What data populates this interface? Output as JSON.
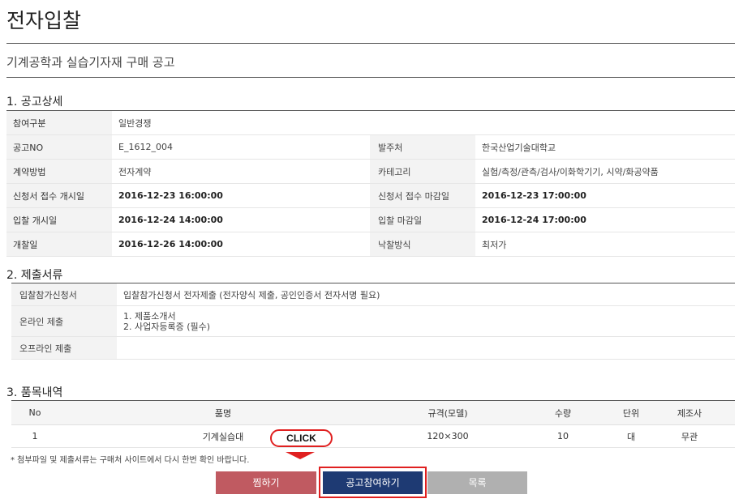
{
  "page": {
    "title": "전자입찰",
    "notice_title": "기계공학과 실습기자재 구매 공고"
  },
  "section1": {
    "title": "1. 공고상세",
    "rows": [
      {
        "label": "참여구분",
        "value": "일반경쟁",
        "label2": "",
        "value2": ""
      },
      {
        "label": "공고NO",
        "value": "E_1612_004",
        "label2": "발주처",
        "value2": "한국산업기술대학교"
      },
      {
        "label": "계약방법",
        "value": "전자계약",
        "label2": "카테고리",
        "value2": "실험/측정/관측/검사/이화학기기, 시약/화공약품"
      },
      {
        "label": "신청서 접수 개시일",
        "value": "2016-12-23 16:00:00",
        "label2": "신청서 접수 마감일",
        "value2": "2016-12-23 17:00:00"
      },
      {
        "label": "입찰 개시일",
        "value": "2016-12-24 14:00:00",
        "label2": "입찰 마감일",
        "value2": "2016-12-24 17:00:00"
      },
      {
        "label": "개찰일",
        "value": "2016-12-26 14:00:00",
        "label2": "낙찰방식",
        "value2": "최저가"
      }
    ]
  },
  "section2": {
    "title": "2. 제출서류",
    "rows": [
      {
        "label": "입찰참가신청서",
        "lines": [
          "입찰참가신청서 전자제출 (전자양식 제출, 공인인증서 전자서명 필요)"
        ]
      },
      {
        "label": "온라인 제출",
        "lines": [
          "1. 제품소개서",
          "2. 사업자등록증 (필수)"
        ]
      },
      {
        "label": "오프라인 제출",
        "lines": []
      }
    ]
  },
  "section3": {
    "title": "3. 품목내역",
    "headers": [
      "No",
      "품명",
      "규격(모델)",
      "수량",
      "단위",
      "제조사"
    ],
    "rows": [
      [
        "1",
        "기계실습대",
        "120×300",
        "10",
        "대",
        "무관"
      ]
    ]
  },
  "footnote": "* 첨부파일 및 제출서류는 구매처 사이트에서 다시 한번 확인 바랍니다.",
  "callout": "CLICK",
  "buttons": {
    "wish": "찜하기",
    "apply": "공고참여하기",
    "list": "목록"
  },
  "colors": {
    "wish_button": "#c05a61",
    "apply_button": "#1e3a73",
    "list_button": "#b0b0b0",
    "highlight": "#e02020"
  }
}
